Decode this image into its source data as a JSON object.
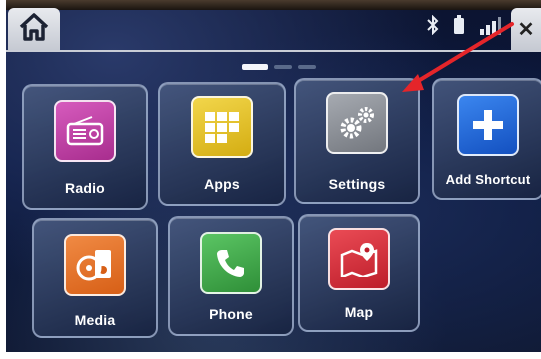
{
  "apps": {
    "radio": "Radio",
    "apps": "Apps",
    "settings": "Settings",
    "add_shortcut": "Add Shortcut",
    "media": "Media",
    "phone": "Phone",
    "map": "Map"
  },
  "status_icons": [
    "bluetooth-icon",
    "battery-icon",
    "signal-icon"
  ],
  "colors": {
    "radio": "#c63ea8",
    "apps": "#e5c21d",
    "settings": "#8a8e95",
    "add_shortcut": "#1c63d6",
    "media": "#e8742a",
    "phone": "#3ca647",
    "map": "#d92e3a",
    "arrow": "#e5252a"
  }
}
